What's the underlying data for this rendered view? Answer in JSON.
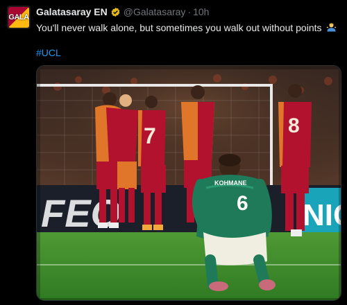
{
  "tweet": {
    "author_name": "Galatasaray EN",
    "avatar_label": "GALA",
    "handle": "@Galatasaray",
    "separator": "·",
    "time": "10h",
    "text": "You'll never walk alone, but sometimes you walk out without points",
    "emoji": "person-shrugging-emoji",
    "hashtag": "#UCL"
  },
  "image": {
    "description_icon": "photo-media",
    "banner_left": "FEO",
    "banner_right": "NIG",
    "player_back_name": "KOHMANE",
    "player_back_number": "6",
    "foreground_shirt_color": "#1f7a5a",
    "opponent_shirt_color": "#b3122e",
    "pitch_color": "#3d8a2a"
  },
  "colors": {
    "background": "#000000",
    "text": "#e7e9ea",
    "muted": "#71767b",
    "link": "#1d9bf0",
    "verified_gold": "#e2b719"
  }
}
